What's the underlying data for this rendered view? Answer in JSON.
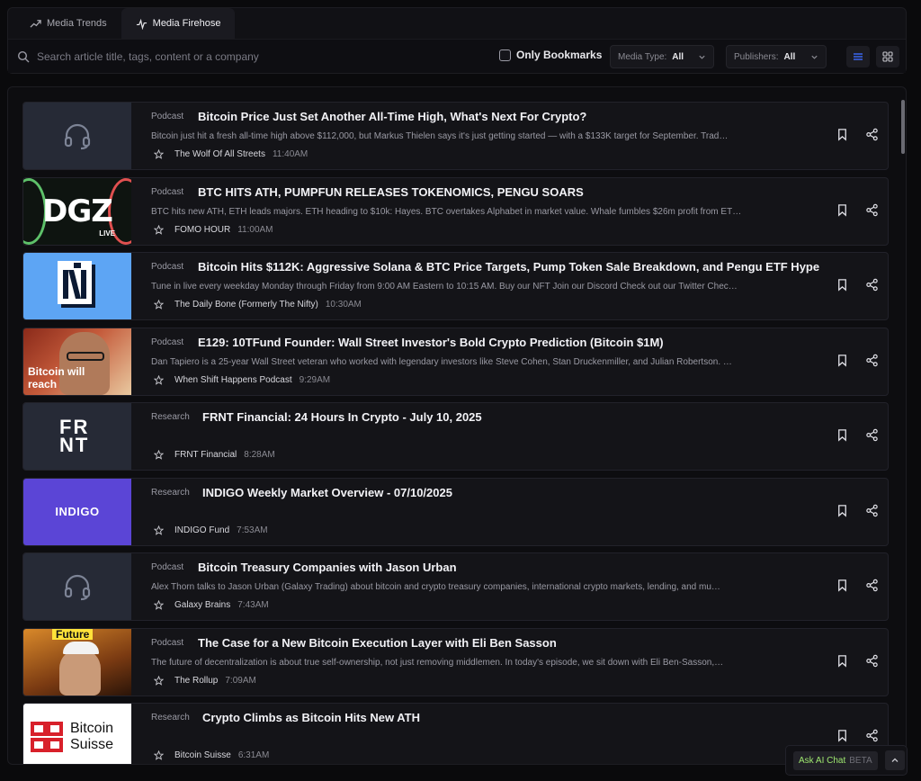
{
  "tabs": [
    {
      "label": "Media Trends",
      "icon": "trending-icon"
    },
    {
      "label": "Media Firehose",
      "icon": "pulse-icon"
    }
  ],
  "search": {
    "placeholder": "Search article title, tags, content or a company"
  },
  "filters": {
    "only_bookmarks_label": "Only Bookmarks",
    "media_type": {
      "label": "Media Type:",
      "value": "All"
    },
    "publishers": {
      "label": "Publishers:",
      "value": "All"
    }
  },
  "colors": {
    "accent": "#3d6bff",
    "ai_green": "#9fe870",
    "indigo": "#5b45d6",
    "nifty_blue": "#5da5f4"
  },
  "articles": [
    {
      "category": "Podcast",
      "title": "Bitcoin Price Just Set Another All-Time High, What's Next For Crypto?",
      "description": "Bitcoin just hit a fresh all-time high above $112,000, but Markus Thielen says it's just getting started — with a $133K target for September. Trad…",
      "publisher": "The Wolf Of All Streets",
      "time": "11:40AM",
      "thumb": "headphones"
    },
    {
      "category": "Podcast",
      "title": "BTC HITS ATH, PUMPFUN RELEASES TOKENOMICS, PENGU SOARS",
      "description": "BTC hits new ATH, ETH leads majors. ETH heading to $10k: Hayes. BTC overtakes Alphabet in market value. Whale fumbles $26m profit from ET…",
      "publisher": "FOMO HOUR",
      "time": "11:00AM",
      "thumb": "dgz",
      "thumb_text": "DGZ",
      "thumb_sub": "LIVE"
    },
    {
      "category": "Podcast",
      "title": "Bitcoin Hits $112K: Aggressive Solana & BTC Price Targets, Pump Token Sale Breakdown, and Pengu ETF Hype",
      "description": "Tune in live every weekday Monday through Friday from 9:00 AM Eastern to 10:15 AM. Buy our NFT Join our Discord Check out our Twitter Chec…",
      "publisher": "The Daily Bone (Formerly The Nifty)",
      "time": "10:30AM",
      "thumb": "nifty"
    },
    {
      "category": "Podcast",
      "title": "E129: 10TFund Founder: Wall Street Investor's Bold Crypto Prediction (Bitcoin $1M)",
      "description": "Dan Tapiero is a 25-year Wall Street veteran who worked with legendary investors like Steve Cohen, Stan Druckenmiller, and Julian Robertson. …",
      "publisher": "When Shift Happens Podcast",
      "time": "9:29AM",
      "thumb": "photo1",
      "thumb_text": "Bitcoin will reach"
    },
    {
      "category": "Research",
      "title": "FRNT Financial: 24 Hours In Crypto - July 10, 2025",
      "description": "",
      "publisher": "FRNT Financial",
      "time": "8:28AM",
      "thumb": "frnt",
      "thumb_text": "FRNT"
    },
    {
      "category": "Research",
      "title": "INDIGO Weekly Market Overview - 07/10/2025",
      "description": "",
      "publisher": "INDIGO Fund",
      "time": "7:53AM",
      "thumb": "indigo",
      "thumb_text": "INDIGO"
    },
    {
      "category": "Podcast",
      "title": "Bitcoin Treasury Companies with Jason Urban",
      "description": "Alex Thorn talks to Jason Urban (Galaxy Trading) about bitcoin and crypto treasury companies, international crypto markets, lending, and mu…",
      "publisher": "Galaxy Brains",
      "time": "7:43AM",
      "thumb": "headphones"
    },
    {
      "category": "Podcast",
      "title": "The Case for a New Bitcoin Execution Layer with Eli Ben Sasson",
      "description": "The future of decentralization is about true self-ownership, not just removing middlemen. In today's episode, we sit down with Eli Ben-Sasson,…",
      "publisher": "The Rollup",
      "time": "7:09AM",
      "thumb": "photo2",
      "thumb_text": "Future"
    },
    {
      "category": "Research",
      "title": "Crypto Climbs as Bitcoin Hits New ATH",
      "description": "",
      "publisher": "Bitcoin Suisse",
      "time": "6:31AM",
      "thumb": "suisse",
      "thumb_text": "Bitcoin Suisse"
    }
  ],
  "ai_chat": {
    "label": "Ask AI Chat",
    "badge": "BETA"
  }
}
